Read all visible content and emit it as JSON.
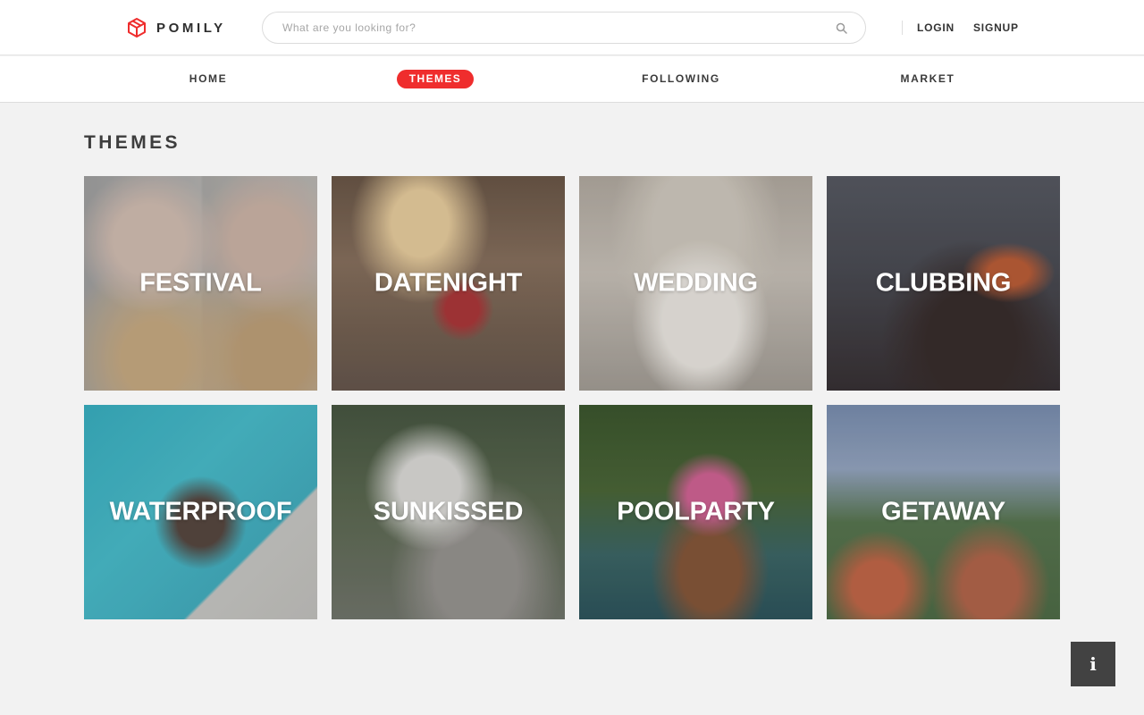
{
  "header": {
    "brand": "POMILY",
    "search": {
      "placeholder": "What are you looking for?",
      "value": ""
    },
    "login_label": "LOGIN",
    "signup_label": "SIGNUP"
  },
  "nav": {
    "items": [
      {
        "label": "HOME",
        "active": false
      },
      {
        "label": "THEMES",
        "active": true
      },
      {
        "label": "FOLLOWING",
        "active": false
      },
      {
        "label": "MARKET",
        "active": false
      }
    ],
    "active_color": "#ef2d2d"
  },
  "main": {
    "title": "THEMES",
    "themes": [
      {
        "label": "FESTIVAL"
      },
      {
        "label": "DATENIGHT"
      },
      {
        "label": "WEDDING"
      },
      {
        "label": "CLUBBING"
      },
      {
        "label": "WATERPROOF"
      },
      {
        "label": "SUNKISSED"
      },
      {
        "label": "POOLPARTY"
      },
      {
        "label": "GETAWAY"
      }
    ]
  },
  "info_button": {
    "label": "i"
  },
  "icons": {
    "logo": "box-logo-icon",
    "search": "search-icon",
    "info": "info-icon"
  },
  "colors": {
    "brand_red": "#ef2d2d",
    "page_bg": "#f2f2f2",
    "info_bg": "#424242"
  }
}
